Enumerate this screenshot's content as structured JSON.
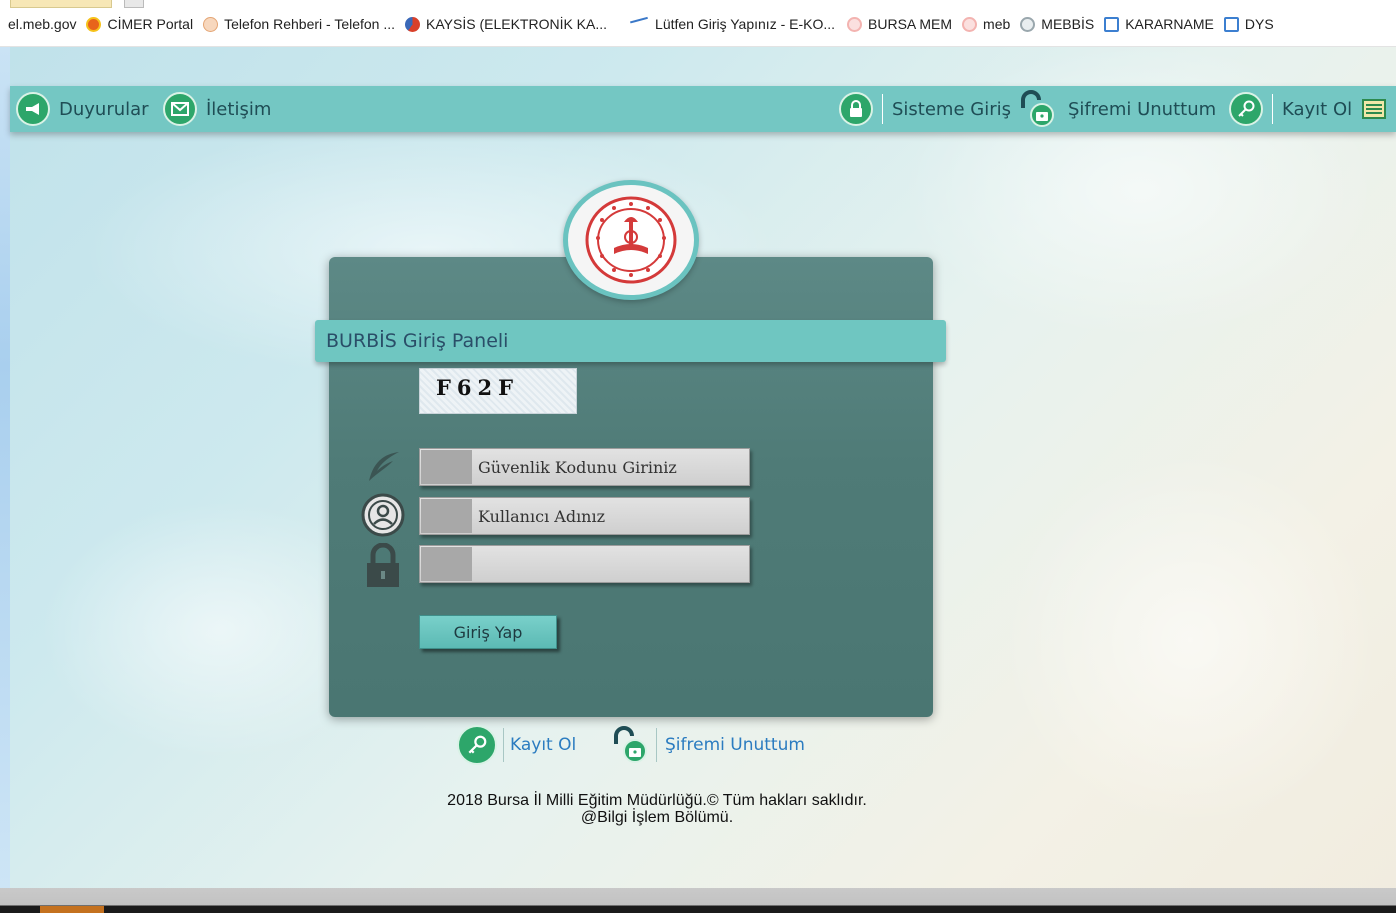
{
  "bookmarks": [
    {
      "label": "el.meb.gov",
      "icon": "none",
      "color": ""
    },
    {
      "label": "CİMER Portal",
      "icon": "cimer-icon",
      "color": "#e8641b"
    },
    {
      "label": "Telefon Rehberi - Telefon ...",
      "icon": "phonebook-icon",
      "color": "#f2c29b"
    },
    {
      "label": "KAYSİS (ELEKTRONİK KA...",
      "icon": "kaysis-icon",
      "color": "#d9402a"
    },
    {
      "label": "Lütfen Giriş Yapınız - E-KO...",
      "icon": "ekoop-icon",
      "color": "#3a78c8"
    },
    {
      "label": "BURSA MEM",
      "icon": "meb-icon",
      "color": "#f3b3b0"
    },
    {
      "label": "meb",
      "icon": "meb-icon",
      "color": "#f3b3b0"
    },
    {
      "label": "MEBBİS",
      "icon": "globe-icon",
      "color": "#9aa"
    },
    {
      "label": "KARARNAME",
      "icon": "ie-icon",
      "color": "#3c7fd0"
    },
    {
      "label": "DYS",
      "icon": "ie-icon",
      "color": "#3c7fd0"
    }
  ],
  "nav": {
    "announcements": "Duyurular",
    "contact": "İletişim",
    "login": "Sisteme Giriş",
    "forgot": "Şifremi Unuttum",
    "register": "Kayıt Ol"
  },
  "panel": {
    "title": "BURBİS Giriş Paneli",
    "captcha_code": "F62F",
    "security_placeholder": "Güvenlik Kodunu Giriniz",
    "username_placeholder": "Kullanıcı Adınız",
    "password_placeholder": "",
    "login_button": "Giriş Yap"
  },
  "below_links": {
    "register": "Kayıt Ol",
    "forgot": "Şifremi Unuttum"
  },
  "footer": {
    "line1": "2018 Bursa İl Milli Eğitim Müdürlüğü.© Tüm hakları saklıdır.",
    "line2": "@Bilgi İşlem Bölümü."
  },
  "colors": {
    "navbar": "#74c7c3",
    "panel": "#4f7b77",
    "accent_green": "#2da66a",
    "link_blue": "#2b7cc0"
  }
}
